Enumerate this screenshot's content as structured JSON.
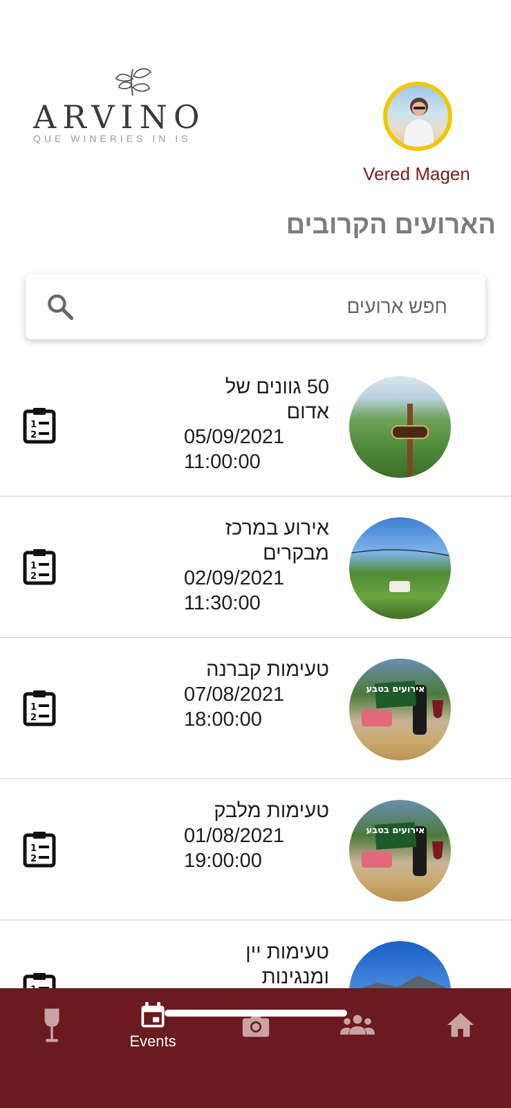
{
  "header": {
    "brand": "ARVINO",
    "tagline": "QUE WINERIES IN IS",
    "user_name": "Vered Magen"
  },
  "section_title": "הארועים הקרובים",
  "search": {
    "placeholder": "חפש ארועים"
  },
  "events": [
    {
      "title": "50 גוונים של אדום",
      "date": "05/09/2021",
      "time": "11:00:00",
      "icon": "clipboard-list-icon"
    },
    {
      "title": "אירוע במרכז מבקרים",
      "date": "02/09/2021",
      "time": "11:30:00",
      "icon": "clipboard-list-icon"
    },
    {
      "title": "טעימות קברנה",
      "date": "07/08/2021",
      "time": "18:00:00",
      "icon": "clipboard-list-icon",
      "thumb_text": "אירועים בטבע"
    },
    {
      "title": "טעימות מלבק",
      "date": "01/08/2021",
      "time": "19:00:00",
      "icon": "clipboard-list-icon",
      "thumb_text": "אירועים בטבע"
    },
    {
      "title": "טעימות יין ומנגינות",
      "icon": "clipboard-list-icon"
    }
  ],
  "bottom_nav": {
    "items": [
      {
        "icon": "wine-glass-icon",
        "label": ""
      },
      {
        "icon": "calendar-icon",
        "label": "Events",
        "active": true
      },
      {
        "icon": "camera-icon",
        "label": ""
      },
      {
        "icon": "people-icon",
        "label": ""
      },
      {
        "icon": "home-icon",
        "label": ""
      }
    ]
  },
  "colors": {
    "brand_maroon": "#6b1a1e",
    "user_name": "#7a1e1e",
    "avatar_ring": "#f2c500",
    "inactive_nav_icon": "#c9a2a4",
    "active_nav_icon": "#ffffff"
  }
}
